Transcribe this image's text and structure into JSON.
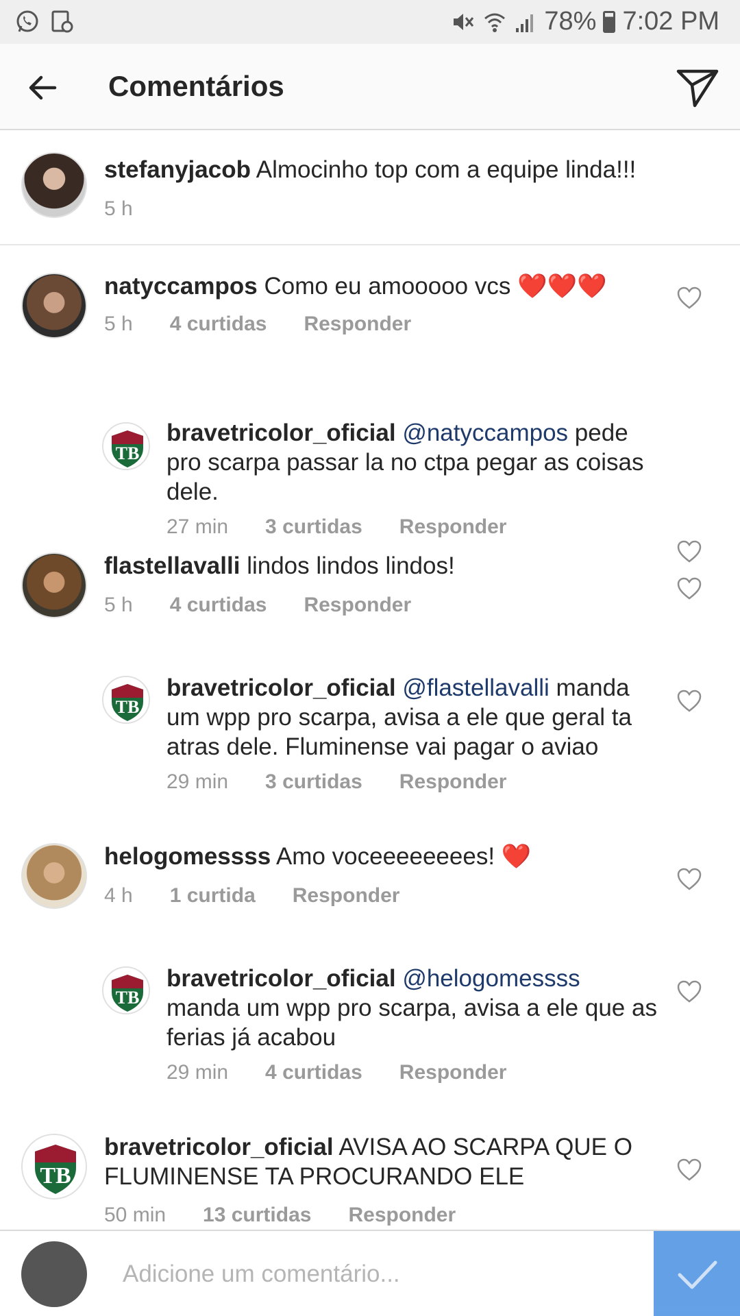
{
  "status_bar": {
    "battery": "78%",
    "time": "7:02 PM",
    "left_icons": [
      "whatsapp-icon",
      "screen-icon"
    ],
    "right_icons": [
      "mute-icon",
      "wifi-icon",
      "signal-icon",
      "battery-icon"
    ]
  },
  "header": {
    "title": "Comentários"
  },
  "caption": {
    "user": "stefanyjacob",
    "text": "Almocinho top com a equipe linda!!!",
    "time": "5 h"
  },
  "comments": [
    {
      "user": "natyccampos",
      "text": "Como eu amooooo vcs ❤️❤️❤️",
      "time": "5 h",
      "likes": "4 curtidas",
      "reply": "Responder"
    },
    {
      "user": "bravetricolor_oficial",
      "mention": "@natyccampos",
      "text": "pede pro scarpa passar la no ctpa pegar as coisas dele.",
      "time": "27 min",
      "likes": "3 curtidas",
      "reply": "Responder"
    },
    {
      "user": "flastellavalli",
      "text": "lindos lindos lindos!",
      "time": "5 h",
      "likes": "4 curtidas",
      "reply": "Responder"
    },
    {
      "user": "bravetricolor_oficial",
      "mention": "@flastellavalli",
      "text": "manda um wpp pro scarpa, avisa a ele que geral ta atras dele. Fluminense vai pagar o aviao",
      "time": "29 min",
      "likes": "3 curtidas",
      "reply": "Responder"
    },
    {
      "user": "helogomessss",
      "text": "Amo voceeeeeeees! ❤️",
      "time": "4 h",
      "likes": "1 curtida",
      "reply": "Responder"
    },
    {
      "user": "bravetricolor_oficial",
      "mention": "@helogomessss",
      "text": "manda um wpp pro scarpa, avisa a ele que as ferias já acabou",
      "time": "29 min",
      "likes": "4 curtidas",
      "reply": "Responder"
    },
    {
      "user": "bravetricolor_oficial",
      "text": "AVISA AO SCARPA QUE O FLUMINENSE TA PROCURANDO ELE",
      "time": "50 min",
      "likes": "13 curtidas",
      "reply": "Responder"
    }
  ],
  "composer": {
    "placeholder": "Adicione um comentário..."
  },
  "colors": {
    "accent_blue": "#4a90e2",
    "mention": "#1e3a6b",
    "muted": "#999999"
  }
}
